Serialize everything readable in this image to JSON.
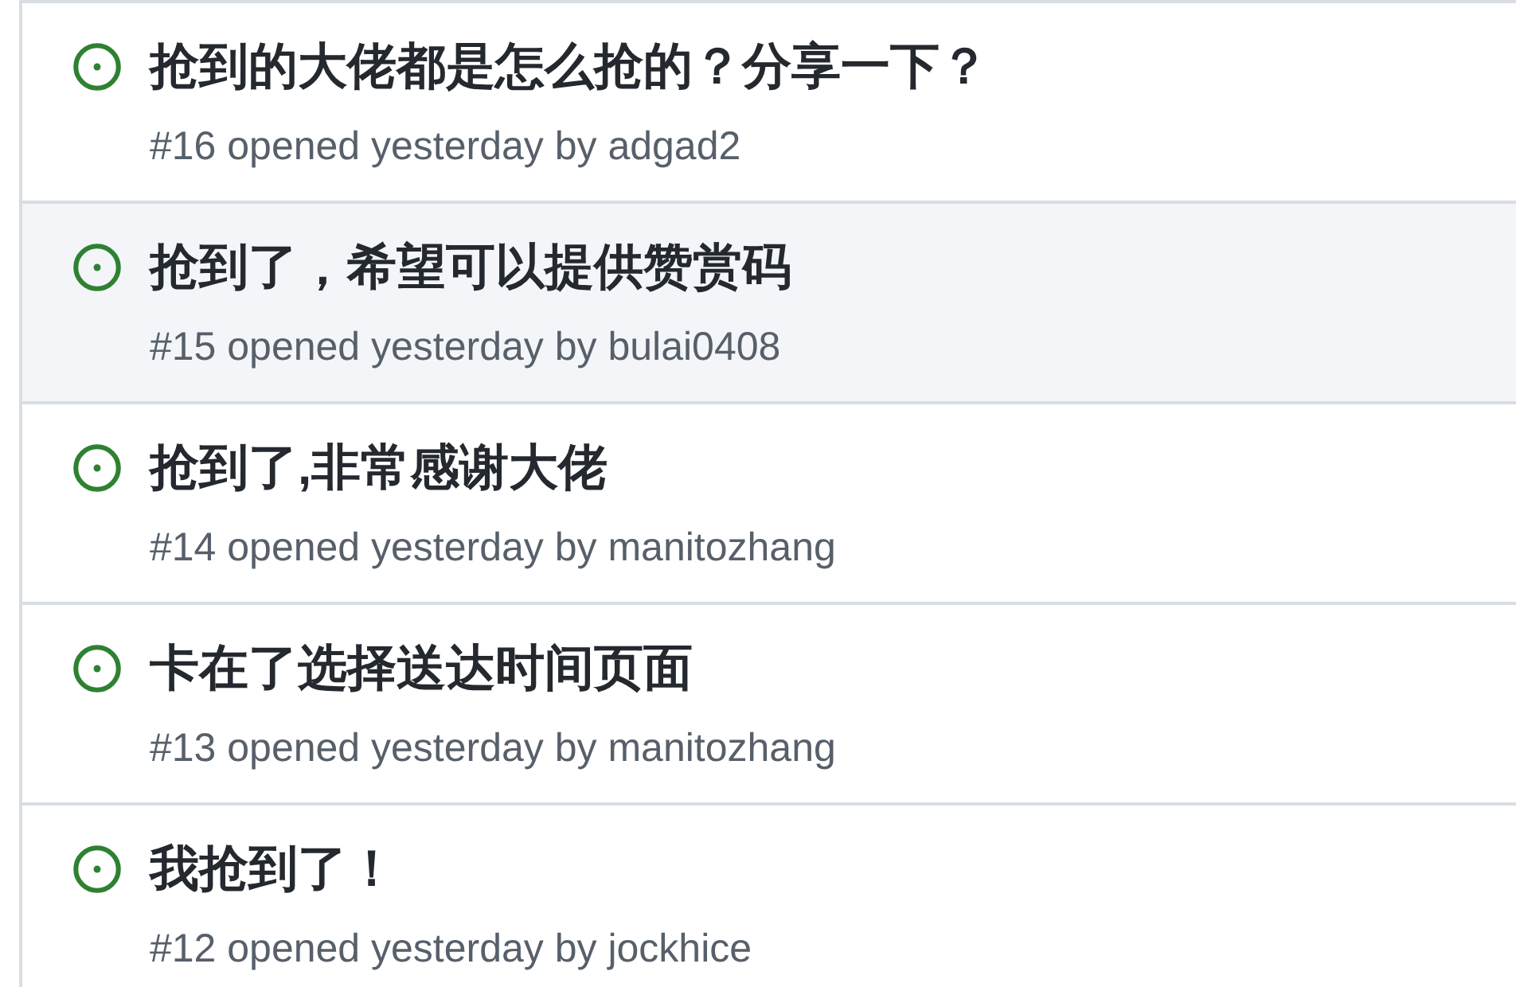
{
  "issues": [
    {
      "title": "抢到的大佬都是怎么抢的？分享一下？",
      "number": "#16",
      "status": "opened yesterday by",
      "author": "adgad2",
      "hovered": false
    },
    {
      "title": "抢到了，希望可以提供赞赏码",
      "number": "#15",
      "status": "opened yesterday by",
      "author": "bulai0408",
      "hovered": true
    },
    {
      "title": "抢到了,非常感谢大佬",
      "number": "#14",
      "status": "opened yesterday by",
      "author": "manitozhang",
      "hovered": false
    },
    {
      "title": "卡在了选择送达时间页面",
      "number": "#13",
      "status": "opened yesterday by",
      "author": "manitozhang",
      "hovered": false
    },
    {
      "title": "我抢到了！",
      "number": "#12",
      "status": "opened yesterday by",
      "author": "jockhice",
      "hovered": false
    }
  ]
}
